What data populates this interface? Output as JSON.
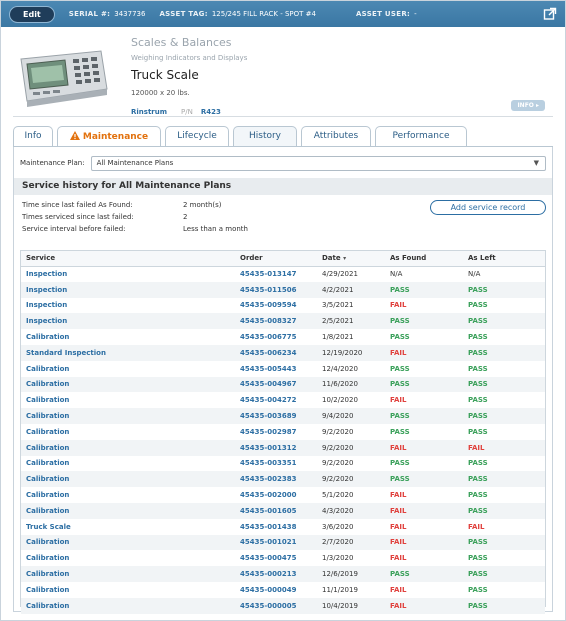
{
  "topbar": {
    "edit_label": "Edit",
    "serial_key": "SERIAL #:",
    "serial_value": "3437736",
    "asset_tag_key": "ASSET TAG:",
    "asset_tag_value": "125/245 FILL RACK - SPOT #4",
    "asset_user_key": "ASSET USER:",
    "asset_user_value": "-",
    "external_icon": "external-link-icon"
  },
  "asset": {
    "category": "Scales & Balances",
    "subcategory": "Weighing Indicators and Displays",
    "name": "Truck Scale",
    "capacity": "120000 x 20 lbs.",
    "manufacturer": "Rinstrum",
    "pn_label": "P/N",
    "pn_value": "R423",
    "info_label": "INFO ▸",
    "image_icon": "weighing-indicator-image"
  },
  "tabs": [
    {
      "label": "Info"
    },
    {
      "label": "Maintenance",
      "icon": "warning-icon"
    },
    {
      "label": "Lifecycle"
    },
    {
      "label": "History"
    },
    {
      "label": "Attributes"
    },
    {
      "label": "Performance"
    }
  ],
  "plan": {
    "label": "Maintenance Plan:",
    "value": "All Maintenance Plans"
  },
  "history": {
    "heading": "Service history for All Maintenance Plans",
    "stats": [
      {
        "label": "Time since last failed As Found:",
        "value": "2 month(s)"
      },
      {
        "label": "Times serviced since last failed:",
        "value": "2"
      },
      {
        "label": "Service interval before failed:",
        "value": "Less than a month"
      }
    ],
    "add_label": "Add service record",
    "columns": [
      "Service",
      "Order",
      "Date",
      "As Found",
      "As Left"
    ],
    "sort_glyph": "▾",
    "rows": [
      {
        "service": "Inspection",
        "order": "45435-013147",
        "date": "4/29/2021",
        "found": "N/A",
        "left": "N/A"
      },
      {
        "service": "Inspection",
        "order": "45435-011506",
        "date": "4/2/2021",
        "found": "PASS",
        "left": "PASS"
      },
      {
        "service": "Inspection",
        "order": "45435-009594",
        "date": "3/5/2021",
        "found": "FAIL",
        "left": "PASS"
      },
      {
        "service": "Inspection",
        "order": "45435-008327",
        "date": "2/5/2021",
        "found": "PASS",
        "left": "PASS"
      },
      {
        "service": "Calibration",
        "order": "45435-006775",
        "date": "1/8/2021",
        "found": "PASS",
        "left": "PASS"
      },
      {
        "service": "Standard Inspection",
        "order": "45435-006234",
        "date": "12/19/2020",
        "found": "FAIL",
        "left": "PASS"
      },
      {
        "service": "Calibration",
        "order": "45435-005443",
        "date": "12/4/2020",
        "found": "PASS",
        "left": "PASS"
      },
      {
        "service": "Calibration",
        "order": "45435-004967",
        "date": "11/6/2020",
        "found": "PASS",
        "left": "PASS"
      },
      {
        "service": "Calibration",
        "order": "45435-004272",
        "date": "10/2/2020",
        "found": "FAIL",
        "left": "PASS"
      },
      {
        "service": "Calibration",
        "order": "45435-003689",
        "date": "9/4/2020",
        "found": "PASS",
        "left": "PASS"
      },
      {
        "service": "Calibration",
        "order": "45435-002987",
        "date": "9/2/2020",
        "found": "PASS",
        "left": "PASS"
      },
      {
        "service": "Calibration",
        "order": "45435-001312",
        "date": "9/2/2020",
        "found": "FAIL",
        "left": "FAIL"
      },
      {
        "service": "Calibration",
        "order": "45435-003351",
        "date": "9/2/2020",
        "found": "PASS",
        "left": "PASS"
      },
      {
        "service": "Calibration",
        "order": "45435-002383",
        "date": "9/2/2020",
        "found": "PASS",
        "left": "PASS"
      },
      {
        "service": "Calibration",
        "order": "45435-002000",
        "date": "5/1/2020",
        "found": "FAIL",
        "left": "PASS"
      },
      {
        "service": "Calibration",
        "order": "45435-001605",
        "date": "4/3/2020",
        "found": "FAIL",
        "left": "PASS"
      },
      {
        "service": "Truck Scale",
        "order": "45435-001438",
        "date": "3/6/2020",
        "found": "FAIL",
        "left": "FAIL"
      },
      {
        "service": "Calibration",
        "order": "45435-001021",
        "date": "2/7/2020",
        "found": "FAIL",
        "left": "PASS"
      },
      {
        "service": "Calibration",
        "order": "45435-000475",
        "date": "1/3/2020",
        "found": "FAIL",
        "left": "PASS"
      },
      {
        "service": "Calibration",
        "order": "45435-000213",
        "date": "12/6/2019",
        "found": "PASS",
        "left": "PASS"
      },
      {
        "service": "Calibration",
        "order": "45435-000049",
        "date": "11/1/2019",
        "found": "FAIL",
        "left": "PASS"
      },
      {
        "service": "Calibration",
        "order": "45435-000005",
        "date": "10/4/2019",
        "found": "FAIL",
        "left": "PASS"
      }
    ]
  },
  "colors": {
    "topbar": "#3f7dab",
    "link": "#2c6ea3",
    "pass": "#3aa05a",
    "fail": "#e0413d",
    "active_tab": "#e2720f"
  }
}
